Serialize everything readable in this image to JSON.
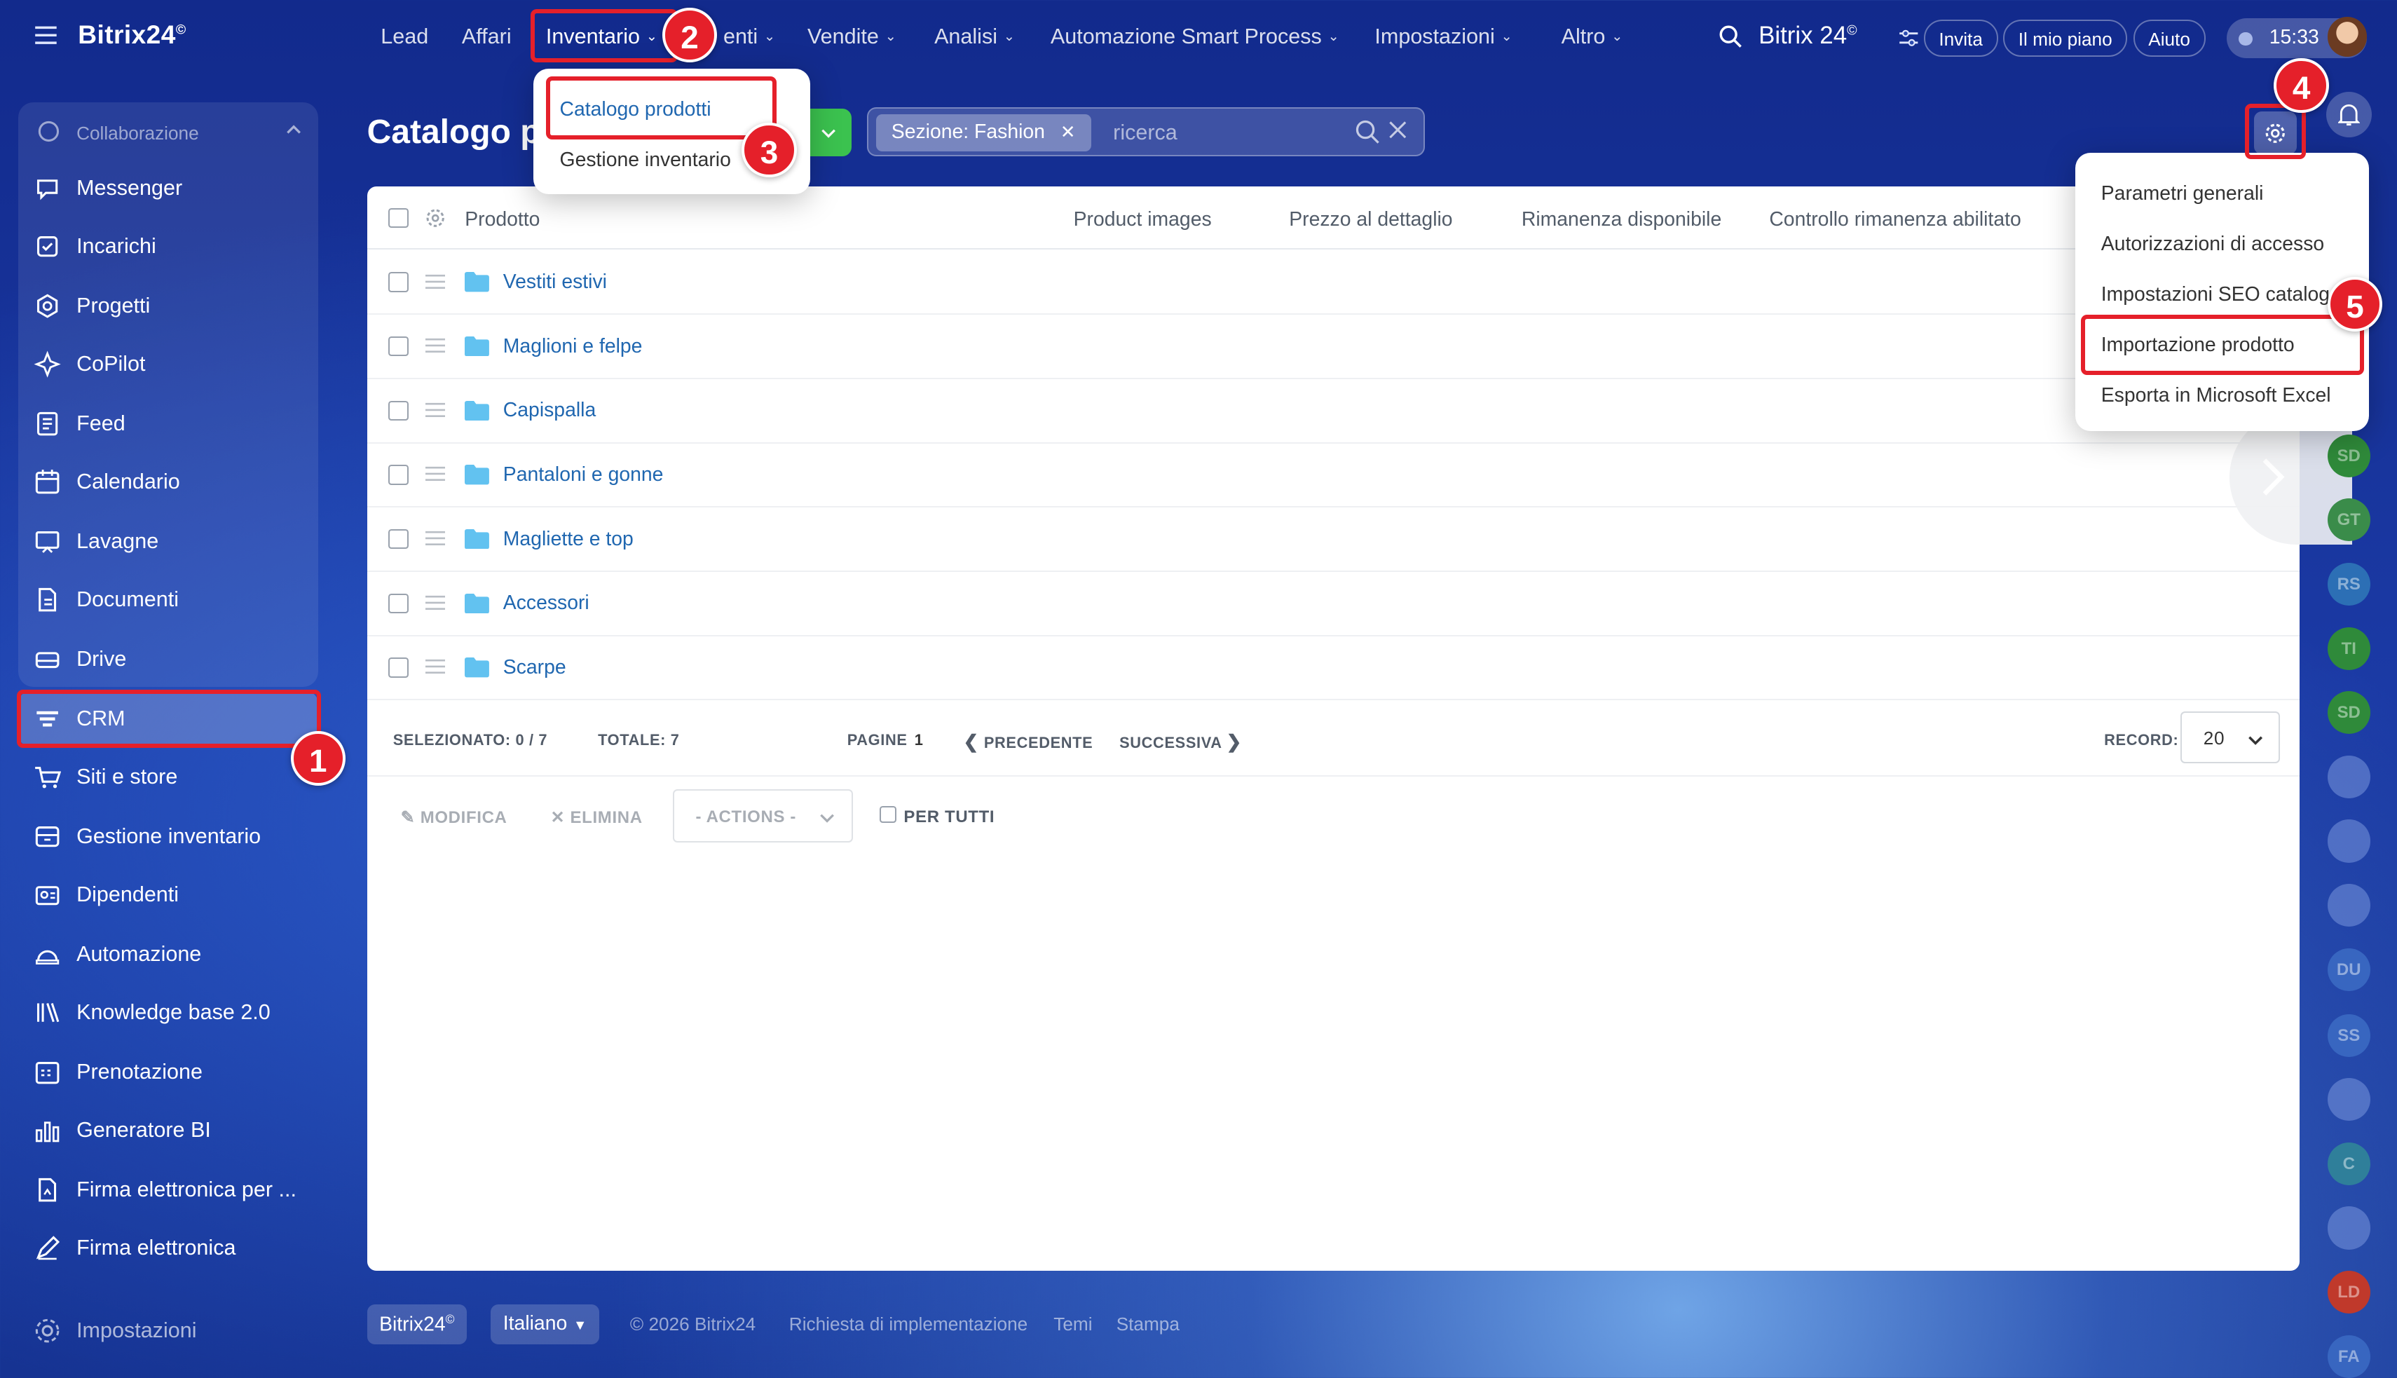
{
  "app": {
    "logo": "Bitrix24",
    "logo_mark": "©"
  },
  "sidebar": {
    "group_label": "Collaborazione",
    "items": [
      {
        "label": "Messenger",
        "icon": "chat-bubble-icon"
      },
      {
        "label": "Incarichi",
        "icon": "checkbox-icon"
      },
      {
        "label": "Progetti",
        "icon": "projects-icon"
      },
      {
        "label": "CoPilot",
        "icon": "copilot-icon"
      },
      {
        "label": "Feed",
        "icon": "feed-icon"
      },
      {
        "label": "Calendario",
        "icon": "calendar-icon"
      },
      {
        "label": "Lavagne",
        "icon": "whiteboard-icon"
      },
      {
        "label": "Documenti",
        "icon": "document-icon"
      },
      {
        "label": "Drive",
        "icon": "drive-icon"
      }
    ],
    "items2": [
      {
        "label": "CRM",
        "icon": "crm-icon"
      },
      {
        "label": "Siti e store",
        "icon": "cart-icon"
      },
      {
        "label": "Gestione inventario",
        "icon": "inventory-icon"
      },
      {
        "label": "Dipendenti",
        "icon": "employees-icon"
      },
      {
        "label": "Automazione",
        "icon": "automation-icon"
      },
      {
        "label": "Knowledge base 2.0",
        "icon": "books-icon"
      },
      {
        "label": "Prenotazione",
        "icon": "booking-icon"
      },
      {
        "label": "Generatore BI",
        "icon": "bar-chart-icon"
      },
      {
        "label": "Firma elettronica per ...",
        "icon": "signature-doc-icon"
      },
      {
        "label": "Firma elettronica",
        "icon": "pen-icon"
      }
    ],
    "settings": "Impostazioni"
  },
  "topnav": {
    "items": [
      "Lead",
      "Affari",
      "Inventario",
      "enti",
      "Vendite",
      "Analisi",
      "Automazione Smart Process",
      "Impostazioni",
      "Altro"
    ],
    "brand": "Bitrix 24",
    "invite": "Invita",
    "plan": "Il mio piano",
    "help": "Aiuto",
    "time": "15:33"
  },
  "inventory_menu": {
    "items": [
      "Catalogo prodotti",
      "Gestione inventario"
    ]
  },
  "page": {
    "title": "Catalogo p"
  },
  "filter": {
    "chip": "Sezione: Fashion",
    "placeholder": "ricerca"
  },
  "grid": {
    "columns": [
      "Prodotto",
      "Product images",
      "Prezzo al dettaglio",
      "Rimanenza disponibile",
      "Controllo rimanenza abilitato"
    ],
    "rows": [
      "Vestiti estivi",
      "Maglioni e felpe",
      "Capispalla",
      "Pantaloni e gonne",
      "Magliette e top",
      "Accessori",
      "Scarpe"
    ],
    "pager": {
      "selected": "SELEZIONATO: 0 / 7",
      "total": "TOTALE: 7",
      "pages": "PAGINE",
      "page_num": "1",
      "prev": "PRECEDENTE",
      "next": "SUCCESSIVA",
      "records": "RECORD:",
      "records_value": "20"
    },
    "actions": {
      "edit": "MODIFICA",
      "delete": "ELIMINA",
      "select": "- ACTIONS -",
      "for_all": "PER TUTTI"
    }
  },
  "settings_menu": {
    "items": [
      "Parametri generali",
      "Autorizzazioni di accesso",
      "Impostazioni SEO catalog",
      "Importazione prodotto",
      "Esporta in Microsoft Excel"
    ]
  },
  "badges": [
    "1",
    "2",
    "3",
    "4",
    "5"
  ],
  "right_avatars": [
    "SD",
    "GT",
    "RS",
    "TI",
    "SD",
    "DU",
    "SS",
    "C",
    "LD",
    "FA"
  ],
  "footer": {
    "brand": "Bitrix24",
    "lang": "Italiano",
    "copyright": "© 2026 Bitrix24",
    "impl": "Richiesta di implementazione",
    "themes": "Temi",
    "print": "Stampa"
  },
  "colors": {
    "accent": "#e5202a",
    "green": "#3bc24f",
    "link": "#2067b0"
  }
}
